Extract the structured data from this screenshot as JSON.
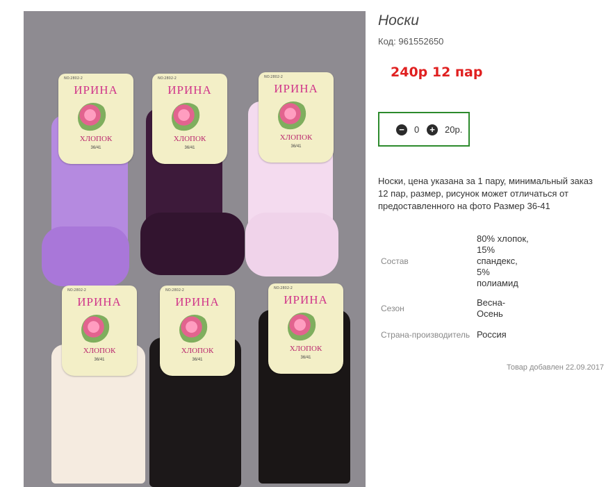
{
  "product": {
    "title": "Носки",
    "sku_label": "Код:",
    "sku_value": "961552650",
    "price_text": "240р 12 пар",
    "description": "Носки, цена указана за 1 пару, минимальный заказ 12 пар, размер, рисунок может отличаться от предоставленного на фото Размер 36-41",
    "added_text": "Товар добавлен 22.09.2017"
  },
  "quantity": {
    "minus_label": "−",
    "plus_label": "+",
    "count": "0",
    "unit_price": "20р."
  },
  "specs": [
    {
      "key": "Состав",
      "value": "80% хлопок, 15% спандекс, 5% полиамид"
    },
    {
      "key": "Сезон",
      "value": "Весна-Осень"
    },
    {
      "key": "Страна-производитель",
      "value": "Россия"
    }
  ],
  "photo": {
    "background": "#8e8b91",
    "cards": [
      {
        "code": "NO:2802-2",
        "brand": "ИРИНА",
        "material": "ХЛОПОК",
        "size": "36/41",
        "sock_color": "#b58ae0"
      },
      {
        "code": "NO:2802-2",
        "brand": "ИРИНА",
        "material": "ХЛОПОК",
        "size": "36/41",
        "sock_color": "#3d1a3a"
      },
      {
        "code": "NO:2802-2",
        "brand": "ИРИНА",
        "material": "ХЛОПОК",
        "size": "36/41",
        "sock_color": "#f4dbef"
      },
      {
        "code": "NO:2802-2",
        "brand": "ИРИНА",
        "material": "ХЛОПОК",
        "size": "36/41",
        "sock_color": "#f5ebe0"
      },
      {
        "code": "NO:2802-2",
        "brand": "ИРИНА",
        "material": "ХЛОПОК",
        "size": "36/41",
        "sock_color": "#1c1819"
      },
      {
        "code": "NO:2802-2",
        "brand": "ИРИНА",
        "material": "ХЛОПОК",
        "size": "36/41",
        "sock_color": "#1a1616"
      }
    ]
  },
  "colors": {
    "price": "#e02020",
    "qty_border": "#2c8a2c"
  }
}
